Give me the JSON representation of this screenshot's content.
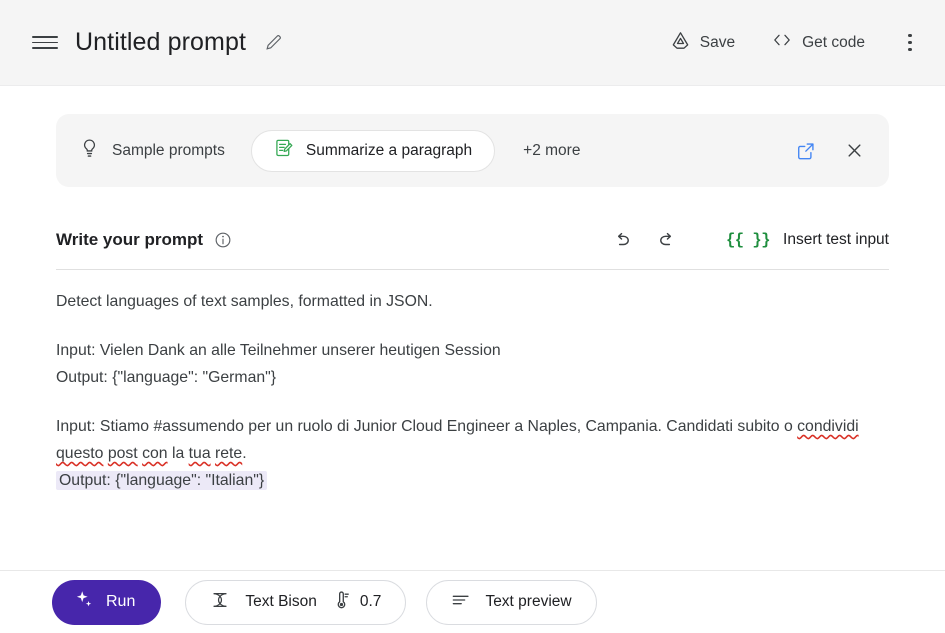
{
  "header": {
    "menu_icon": "hamburger-menu-icon",
    "title": "Untitled prompt",
    "edit_icon": "pencil-edit-icon",
    "save_label": "Save",
    "save_icon": "drive-save-icon",
    "get_code_label": "Get code",
    "get_code_icon": "code-brackets-icon",
    "overflow_icon": "kebab-menu-icon"
  },
  "sample_bar": {
    "icon": "lightbulb-icon",
    "label": "Sample prompts",
    "chip": {
      "icon": "note-edit-icon",
      "label": "Summarize a paragraph"
    },
    "more_label": "+2 more",
    "open_icon": "open-in-new-icon",
    "close_icon": "close-x-icon"
  },
  "prompt_section": {
    "title": "Write your prompt",
    "info_icon": "info-circle-icon",
    "undo_icon": "undo-arrow-icon",
    "redo_icon": "redo-arrow-icon",
    "braces": "{{ }}",
    "insert_label": "Insert test input",
    "paragraphs": [
      {
        "lines": [
          "Detect languages of text samples, formatted in JSON."
        ]
      },
      {
        "lines": [
          "Input: Vielen Dank an alle Teilnehmer unserer heutigen Session",
          "Output: {\"language\": \"German\"}"
        ]
      }
    ],
    "example_two": {
      "input_prefix": "Input: Stiamo #assumendo per un ruolo di Junior Cloud Engineer a Naples, Campania. Candidati subito o ",
      "misspelled": [
        "condividi",
        "questo",
        "post",
        "con",
        "tua",
        "rete"
      ],
      "word_la": "la",
      "period": ".",
      "output_highlight": "Output: {\"language\": \"Italian\"}"
    }
  },
  "footer": {
    "run_label": "Run",
    "run_icon": "sparkle-icon",
    "model_icon": "model-atom-icon",
    "model_label": "Text Bison",
    "temperature_icon": "thermometer-icon",
    "temperature_value": "0.7",
    "preview_icon": "text-lines-icon",
    "preview_label": "Text preview"
  },
  "colors": {
    "header_bg": "#f5f5f5",
    "accent_purple": "#4726ab",
    "brace_green": "#1e8e3e",
    "highlight_lavender": "#ece9f7",
    "spellcheck_red": "#d93025",
    "link_blue": "#4285f4"
  }
}
